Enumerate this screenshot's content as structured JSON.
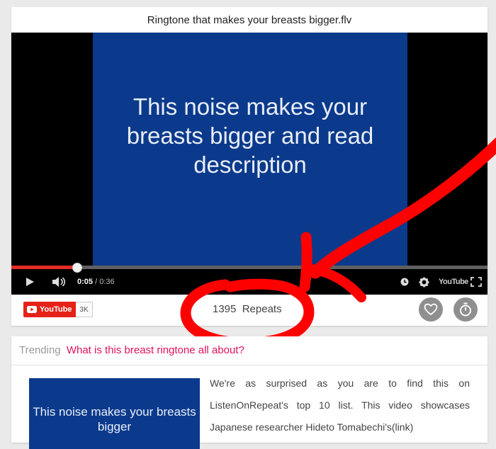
{
  "video": {
    "title": "Ringtone that makes your breasts bigger.flv",
    "frame_text": "This noise makes your breasts bigger and read description",
    "progress": 0.138,
    "time_current": "0:05",
    "time_separator": " / ",
    "time_total": "0:36",
    "youtube_logo": "YouTube"
  },
  "toolbar": {
    "youtube_label": "YouTube",
    "youtube_count": "3K",
    "repeat_count": "1395",
    "repeat_label": "Repeats"
  },
  "trending": {
    "label": "Trending",
    "link_text": "What is this breast ringtone all about?",
    "thumb_text": "This noise makes your breasts bigger",
    "description": "We're as surprised as you are to find this on ListenOnRepeat's top 10 list. This video showcases Japanese researcher Hideto Tomabechi's(link)"
  },
  "colors": {
    "accent_pink": "#e0115f",
    "youtube_red": "#e62117",
    "annotation_red": "#ff0000",
    "frame_blue": "#0b3a8c"
  }
}
